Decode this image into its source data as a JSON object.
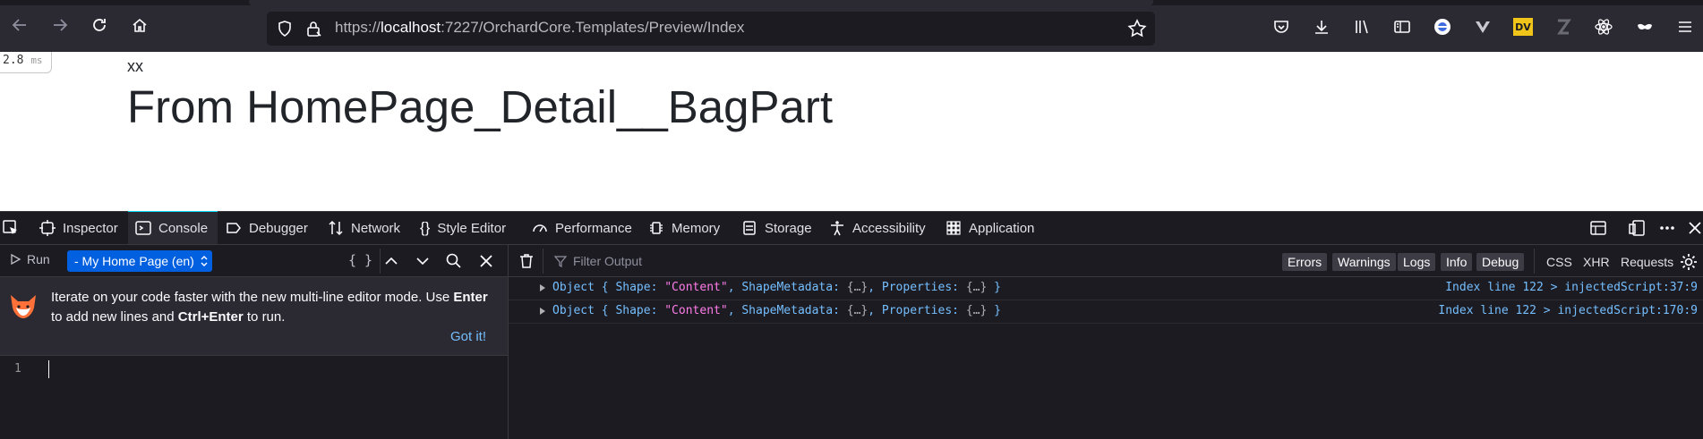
{
  "browser": {
    "url_prefix": "https://",
    "url_host": "localhost",
    "url_rest": ":7227/OrchardCore.Templates/Preview/Index",
    "ext_badge": "DV"
  },
  "page": {
    "timing_value": "2.8",
    "timing_unit": "ms",
    "small_text": "xx",
    "heading": "From HomePage_Detail__BagPart"
  },
  "devtools": {
    "tabs": [
      {
        "label": "Inspector",
        "icon": "inspector-icon"
      },
      {
        "label": "Console",
        "icon": "console-icon"
      },
      {
        "label": "Debugger",
        "icon": "debugger-icon"
      },
      {
        "label": "Network",
        "icon": "network-icon"
      },
      {
        "label": "Style Editor",
        "icon": "style-editor-icon"
      },
      {
        "label": "Performance",
        "icon": "performance-icon"
      },
      {
        "label": "Memory",
        "icon": "memory-icon"
      },
      {
        "label": "Storage",
        "icon": "storage-icon"
      },
      {
        "label": "Accessibility",
        "icon": "accessibility-icon"
      },
      {
        "label": "Application",
        "icon": "application-icon"
      }
    ],
    "selected_tab": "Console",
    "editor": {
      "run_label": "Run",
      "context_label": "- My Home Page (en)",
      "braces_label": "{ }",
      "notification_line1_a": "Iterate on your code faster with the new multi-line editor mode. Use ",
      "notification_key1": "Enter",
      "notification_line2_a": "to add new lines and ",
      "notification_key2": "Ctrl+Enter",
      "notification_line2_b": " to run.",
      "got_it": "Got it!",
      "line_number": "1"
    },
    "output": {
      "filter_placeholder": "Filter Output",
      "filters": [
        "Errors",
        "Warnings",
        "Logs",
        "Info",
        "Debug"
      ],
      "net_filters": [
        "CSS",
        "XHR",
        "Requests"
      ],
      "messages": [
        {
          "prefix": "Object { Shape: ",
          "string": "\"Content\"",
          "mid": ", ShapeMetadata: ",
          "elided1": "{…}",
          "mid2": ", Properties: ",
          "elided2": "{…}",
          "suffix": " }",
          "location": "Index line 122 > injectedScript:37:9"
        },
        {
          "prefix": "Object { Shape: ",
          "string": "\"Content\"",
          "mid": ", ShapeMetadata: ",
          "elided1": "{…}",
          "mid2": ", Properties: ",
          "elided2": "{…}",
          "suffix": " }",
          "location": "Index line 122 > injectedScript:170:9"
        }
      ]
    }
  }
}
